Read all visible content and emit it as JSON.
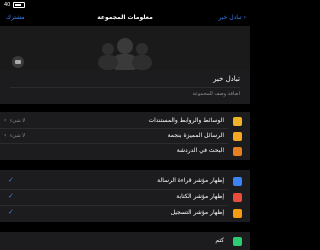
{
  "status": {
    "time": "",
    "carrier": "40"
  },
  "nav": {
    "title": "معلومات المجموعة",
    "back_label": "تبادل خبر",
    "cancel_label": "مشترك"
  },
  "group": {
    "name": "تبادل خبر",
    "description_placeholder": "اضافة وصف للمجموعة"
  },
  "settings": [
    {
      "label": "الوسائط والروابط والمستندات",
      "value": "لا شيء",
      "color": "#f0b429"
    },
    {
      "label": "الرسائل المميزة بنجمة",
      "value": "لا شيء",
      "color": "#f5a623"
    },
    {
      "label": "البحث في الدردشة",
      "value": "",
      "color": "#e67e22"
    }
  ],
  "checks": [
    {
      "label": "إظهار مؤشر قراءة الرسالة",
      "color": "#3b82f6"
    },
    {
      "label": "إظهار مؤشر الكتابة",
      "color": "#e74c3c"
    },
    {
      "label": "إظهار مؤشر التسجيل",
      "color": "#f39c12"
    }
  ],
  "bottom": {
    "label": "كتم",
    "color": "#2ecc71"
  }
}
